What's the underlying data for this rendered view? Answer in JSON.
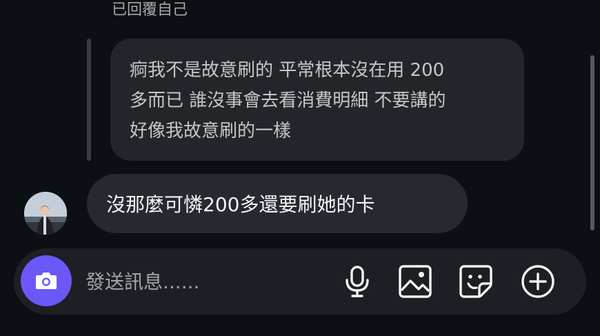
{
  "thread": {
    "reply_label": "已回覆自己",
    "quoted_message": {
      "lines": [
        "痾我不是故意刷的 平常根本沒在用 200",
        "多而已 誰沒事會去看消費明細 不要講的",
        "好像我故意刷的一樣"
      ]
    },
    "message": {
      "text": "沒那麼可憐200多還要刷她的卡"
    }
  },
  "composer": {
    "placeholder": "發送訊息......",
    "value": "",
    "accent_color": "#6b58f6",
    "icons": [
      "camera-icon",
      "microphone-icon",
      "image-icon",
      "sticker-icon",
      "plus-icon"
    ]
  }
}
